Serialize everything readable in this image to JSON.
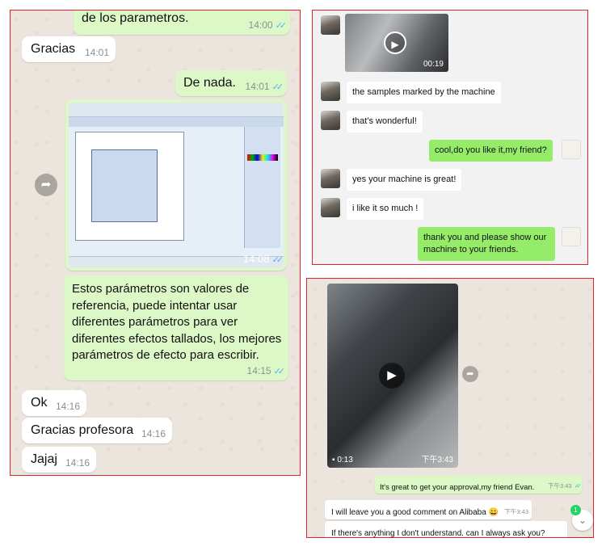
{
  "left": {
    "messages": [
      {
        "text": "de los parametros.",
        "time": "14:00"
      },
      {
        "text": "Gracias",
        "time": "14:01"
      },
      {
        "text": "De nada.",
        "time": "14:01"
      },
      {
        "text": "",
        "time": "14:08"
      },
      {
        "text": "Estos parámetros son valores de referencia, puede intentar usar diferentes parámetros para ver diferentes efectos tallados, los mejores parámetros de efecto para escribir.",
        "time": "14:15"
      },
      {
        "text": "Ok",
        "time": "14:16"
      },
      {
        "text": "Gracias profesora",
        "time": "14:16"
      },
      {
        "text": "Jajaj",
        "time": "14:16"
      }
    ],
    "ticks": "✓✓"
  },
  "wechat": {
    "video_duration": "00:19",
    "messages": [
      {
        "text": "the samples marked by the machine"
      },
      {
        "text": "that's wonderful!"
      },
      {
        "text": "cool,do you like it,my friend?"
      },
      {
        "text": "yes your machine is great!"
      },
      {
        "text": "i like it so much !"
      },
      {
        "text": "thank you and please show our machine to your friends."
      }
    ]
  },
  "wa2": {
    "video": {
      "duration": "0:13",
      "time": "下午3:43"
    },
    "messages": [
      {
        "text": "It's great to get your approval,my friend Evan.",
        "time": "下午3:43"
      },
      {
        "text": "I will leave you a good comment on Alibaba 😀",
        "time": "下午3:43"
      },
      {
        "text": "If there's anything I don't understand. can I always ask you?"
      }
    ],
    "unread_badge": "1"
  },
  "colors": {
    "wa_out": "#dcf8c6",
    "wechat_out": "#95ec69",
    "tick": "#4fb6ec",
    "frame": "#d9262b"
  }
}
